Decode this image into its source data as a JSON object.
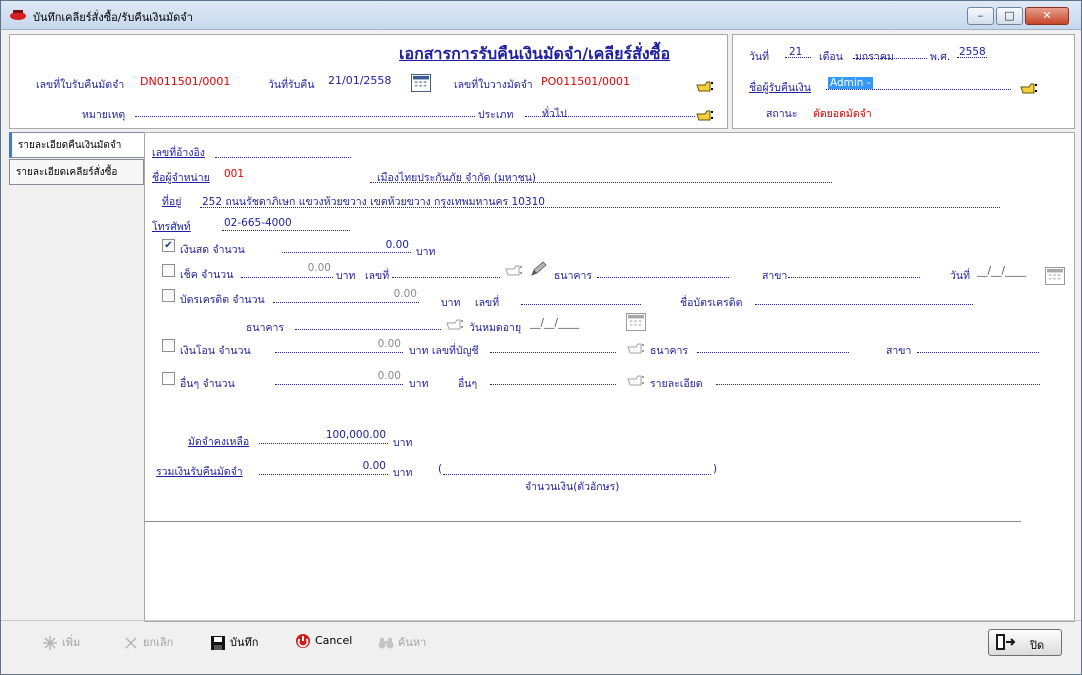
{
  "window": {
    "title": "บันทึกเคลียร์สั่งซื้อ/รับคืนเงินมัดจำ",
    "min_glyph": "–",
    "max_glyph": "□",
    "close_glyph": "✕"
  },
  "header": {
    "doc_title": "เอกสารการรับคืนเงินมัดจำ/เคลียร์สั่งซื้อ",
    "refund_no_label": "เลขที่ใบรับคืนมัดจำ",
    "refund_no_value": "DN011501/0001",
    "return_date_label": "วันที่รับคืน",
    "return_date_value": "21/01/2558",
    "deposit_no_label": "เลขที่ใบวางมัดจำ",
    "deposit_no_value": "PO011501/0001",
    "remark_label": "หมายเหตุ",
    "remark_value": "",
    "type_label": "ประเภท",
    "type_value": "ทั่วไป"
  },
  "date_panel": {
    "day_label": "วันที่",
    "day_value": "21",
    "month_label": "เดือน",
    "month_value": "มกราคม",
    "year_label": "พ.ศ.",
    "year_value": "2558",
    "receiver_label": "ชื่อผู้รับคืนเงิน",
    "receiver_value": "Admin -",
    "status_label": "สถานะ",
    "status_value": "ตัดยอดมัดจำ"
  },
  "tabs": [
    {
      "label": "รายละเอียดคืนเงินมัดจำ"
    },
    {
      "label": "รายละเอียดเคลียร์สั่งซื้อ"
    }
  ],
  "detail": {
    "ref_no_label": "เลขที่อ้างอิง",
    "ref_no_value": "",
    "vendor_label": "ชื่อผู้จำหน่าย",
    "vendor_code": "001",
    "vendor_name": "เมืองไทยประกันภัย จำกัด (มหาชน)",
    "address_label": "ที่อยู่",
    "address_value": "252 ถนนรัชดาภิเษก แขวงห้วยขวาง เขตห้วยขวาง กรุงเทพมหานคร 10310",
    "phone_label": "โทรศัพท์",
    "phone_value": "02-665-4000",
    "cash_label": "เงินสด จำนวน",
    "cash_value": "0.00",
    "cash_checked": true,
    "baht": "บาท",
    "cheque_label": "เช็ค จำนวน",
    "cheque_value": "0.00",
    "cheque_no_label": "เลขที่",
    "bank_label": "ธนาคาร",
    "branch_label": "สาขา",
    "date_label": "วันที่",
    "date_placeholder": "__/__/____",
    "credit_label": "บัตรเครดิต  จำนวน",
    "credit_value": "0.00",
    "credit_no_label": "เลขที่",
    "card_name_label": "ชื่อบัตรเครดิต",
    "credit_bank_label": "ธนาคาร",
    "expiry_label": "วันหมดอายุ",
    "expiry_placeholder": "__/__/____",
    "transfer_label": "เงินโอน จำนวน",
    "transfer_value": "0.00",
    "account_label": "บาท  เลขที่บัญชี",
    "transfer_bank_label": "ธนาคาร",
    "transfer_branch_label": "สาขา",
    "other_label": "อื่นๆ จำนวน",
    "other_value": "0.00",
    "other_type_label": "อื่นๆ",
    "other_detail_label": "รายละเอียด",
    "remaining_label": "มัดจำคงเหลือ",
    "remaining_value": "100,000.00",
    "total_label": "รวมเงินรับคืนมัดจำ",
    "total_value": "0.00",
    "words_open": "(",
    "words_close": ")",
    "words_caption": "จำนวนเงิน(ตัวอักษร)"
  },
  "toolbar": {
    "add": "เพิ่ม",
    "cancel_doc": "ยกเลิก",
    "save": "บันทึก",
    "cancel": "Cancel",
    "search": "ค้นหา",
    "close": "ปิด"
  },
  "colors": {
    "value_blue": "#1f1f9f",
    "value_red": "#e00000",
    "selection": "#3399ff"
  }
}
